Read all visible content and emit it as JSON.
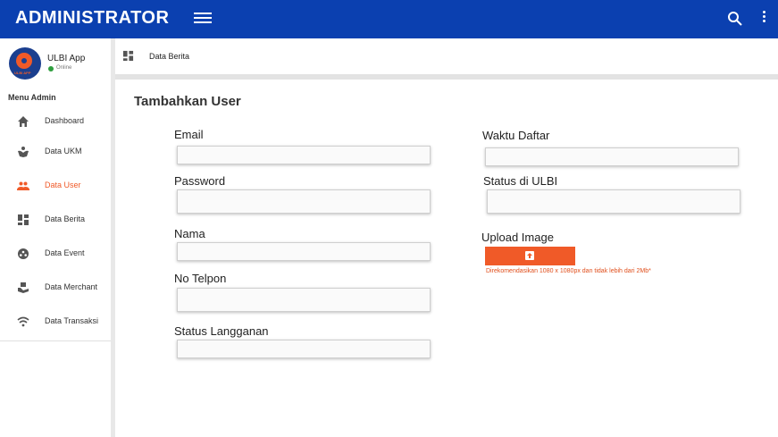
{
  "header": {
    "title": "ADMINISTRATOR",
    "bg_color": "#0b40b0"
  },
  "profile": {
    "app_name": "ULBI App",
    "status": "Online",
    "logo_text": "ULBI APP"
  },
  "sidebar": {
    "menu_title": "Menu Admin",
    "items": [
      {
        "label": "Dashboard",
        "icon": "home-icon"
      },
      {
        "label": "Data UKM",
        "icon": "group-hands-icon"
      },
      {
        "label": "Data User",
        "icon": "people-icon",
        "active": true
      },
      {
        "label": "Data Berita",
        "icon": "dashboard-grid-icon"
      },
      {
        "label": "Data Event",
        "icon": "ball-icon"
      },
      {
        "label": "Data Merchant",
        "icon": "hand-box-icon"
      },
      {
        "label": "Data Transaksi",
        "icon": "wifi-icon"
      }
    ]
  },
  "breadcrumb": {
    "label": "Data Berita"
  },
  "form": {
    "title": "Tambahkan User",
    "fields": {
      "email": {
        "label": "Email",
        "value": ""
      },
      "password": {
        "label": "Password",
        "value": ""
      },
      "nama": {
        "label": "Nama",
        "value": ""
      },
      "telpon": {
        "label": "No Telpon",
        "value": ""
      },
      "langganan": {
        "label": "Status Langganan",
        "value": ""
      },
      "waktu": {
        "label": "Waktu Daftar",
        "value": ""
      },
      "status": {
        "label": "Status di ULBI",
        "value": ""
      }
    },
    "upload": {
      "label": "Upload Image",
      "hint": "Direkomendasikan 1080 x 1080px dan tidak lebih dari 2Mb*"
    }
  },
  "colors": {
    "accent": "#f05a28",
    "primary": "#0b40b0"
  }
}
